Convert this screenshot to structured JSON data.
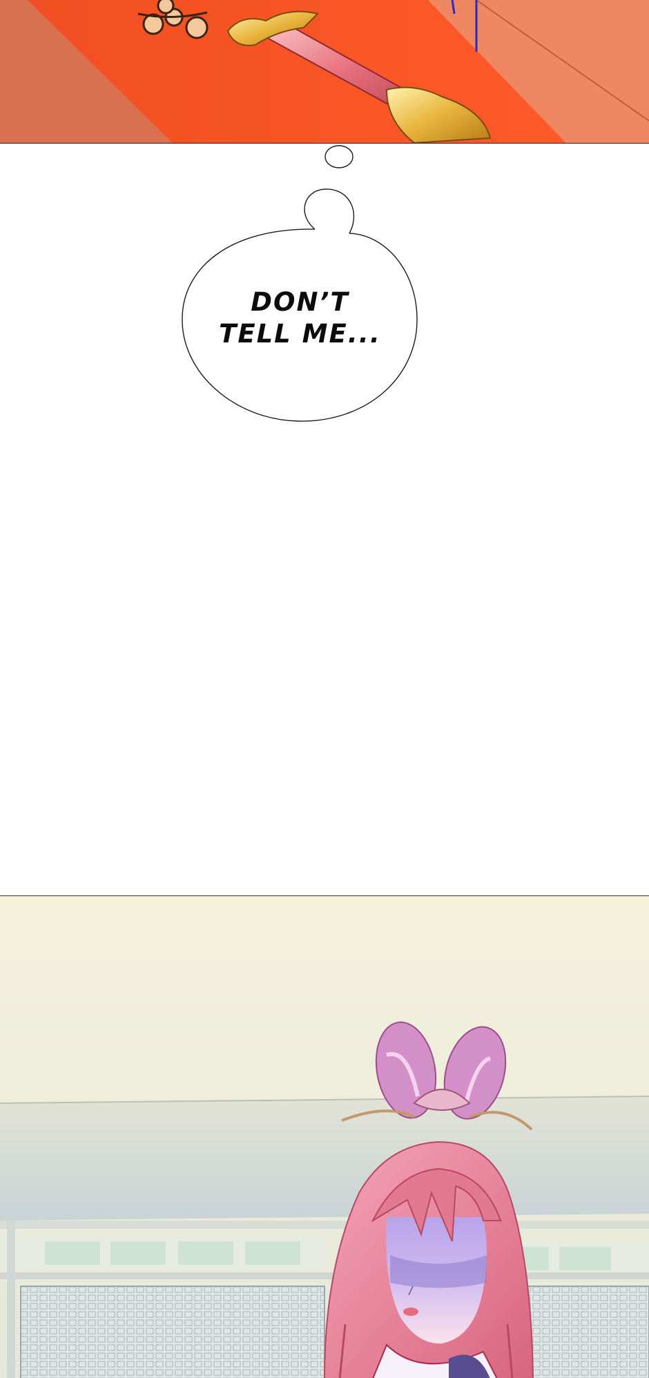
{
  "speech_bubble": {
    "line1": "DON’T",
    "line2": "TELL ME..."
  },
  "colors": {
    "top_panel_red": "#f2542b",
    "bubble_outline": "#1a1a1a",
    "hair_pink": "#e88aa3"
  },
  "illustrations": {
    "top_panel": "sword-on-red-cloth",
    "bottom_panel": "pink-haired-woman-in-courtyard"
  }
}
